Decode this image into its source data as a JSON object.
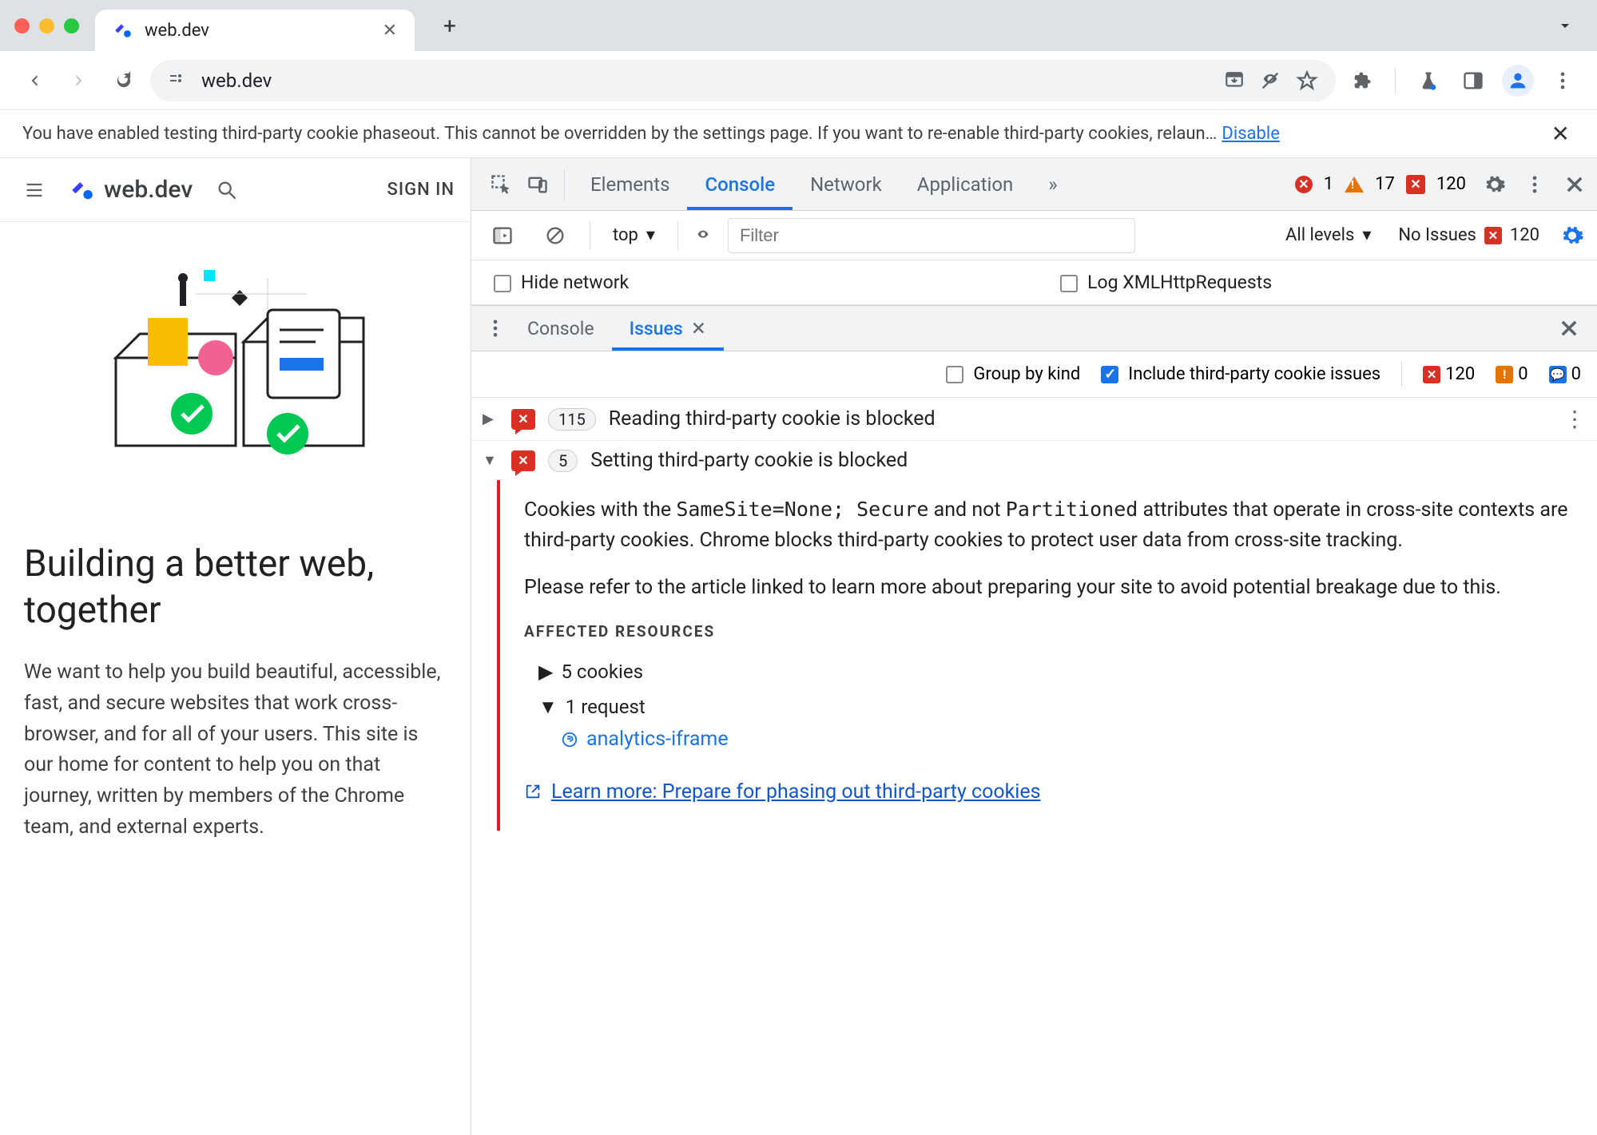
{
  "browser": {
    "tab_title": "web.dev",
    "url": "web.dev",
    "info_bar_text": "You have enabled testing third-party cookie phaseout. This cannot be overridden by the settings page. If you want to re-enable third-party cookies, relaun…",
    "info_bar_link": "Disable"
  },
  "page": {
    "brand": "web.dev",
    "sign_in": "SIGN IN",
    "h1": "Building a better web, together",
    "body": "We want to help you build beautiful, accessible, fast, and secure websites that work cross-browser, and for all of your users. This site is our home for content to help you on that journey, written by members of the Chrome team, and external experts."
  },
  "devtools": {
    "main_tabs": [
      "Elements",
      "Console",
      "Network",
      "Application"
    ],
    "main_active": "Console",
    "counts": {
      "errors": 1,
      "warnings": 17,
      "other": 120
    },
    "console_bar": {
      "context": "top",
      "filter_placeholder": "Filter",
      "levels_label": "All levels",
      "no_issues_label": "No Issues",
      "no_issues_count": 120
    },
    "check_hide_network": "Hide network",
    "check_log_xhr": "Log XMLHttpRequests",
    "drawer_tabs": [
      "Console",
      "Issues"
    ],
    "drawer_active": "Issues",
    "issues_toolbar": {
      "group_by_kind": "Group by kind",
      "include_3p": "Include third-party cookie issues",
      "flag_counts": {
        "red": 120,
        "orange": 0,
        "blue": 0
      }
    },
    "issues": [
      {
        "count": 115,
        "title": "Reading third-party cookie is blocked",
        "expanded": false
      },
      {
        "count": 5,
        "title": "Setting third-party cookie is blocked",
        "expanded": true
      }
    ],
    "issue_detail": {
      "para1_pre": "Cookies with the ",
      "code1": "SameSite=None; Secure",
      "para1_mid": " and not ",
      "code2": "Partitioned",
      "para1_post": " attributes that operate in cross-site contexts are third-party cookies. Chrome blocks third-party cookies to protect user data from cross-site tracking.",
      "para2": "Please refer to the article linked to learn more about preparing your site to avoid potential breakage due to this.",
      "affected_heading": "AFFECTED RESOURCES",
      "affected_cookies": "5 cookies",
      "affected_requests": "1 request",
      "affected_request_name": "analytics-iframe",
      "learn_more": "Learn more: Prepare for phasing out third-party cookies"
    }
  }
}
